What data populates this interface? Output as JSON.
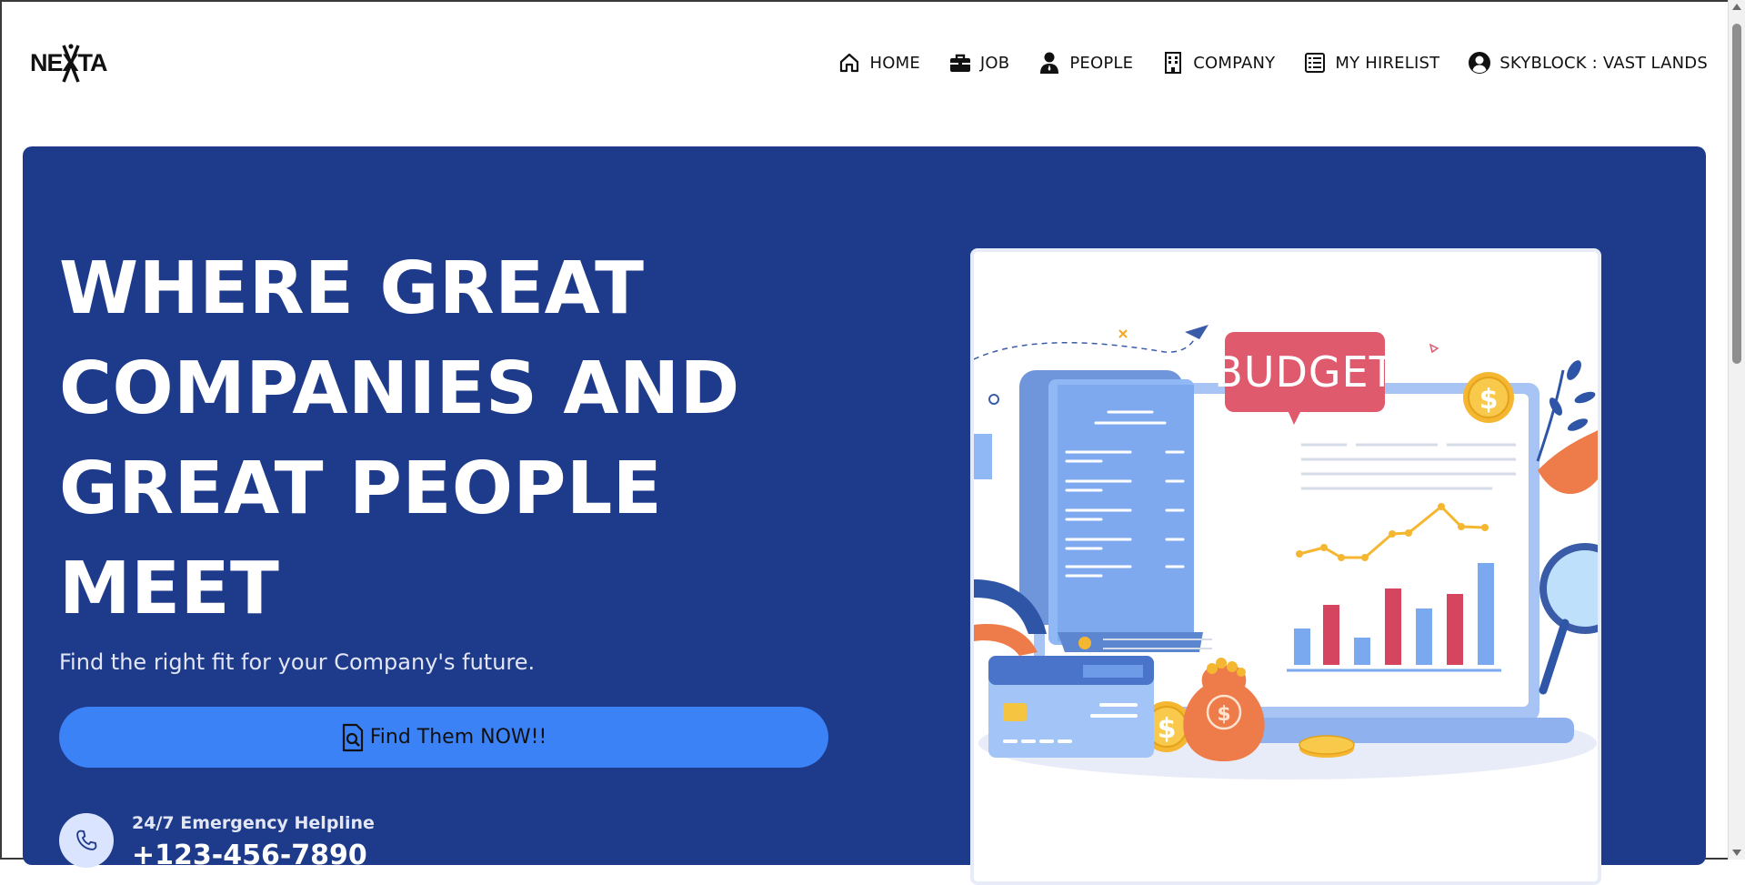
{
  "brand": {
    "logo_text": "NEXTA"
  },
  "nav": {
    "items": [
      {
        "label": "HOME",
        "icon": "home-icon"
      },
      {
        "label": "JOB",
        "icon": "briefcase-icon"
      },
      {
        "label": "PEOPLE",
        "icon": "person-icon"
      },
      {
        "label": "COMPANY",
        "icon": "building-icon"
      },
      {
        "label": "MY HIRELIST",
        "icon": "list-icon"
      },
      {
        "label": "SKYBLOCK : VAST LANDS",
        "icon": "user-circle-icon"
      }
    ]
  },
  "hero": {
    "headline": "WHERE GREAT COMPANIES AND GREAT PEOPLE MEET",
    "subtitle": "Find the right fit for your Company's future.",
    "cta_label": "Find Them NOW!!",
    "helpline_title": "24/7 Emergency Helpline",
    "helpline_number": "+123-456-7890",
    "illustration": {
      "sign_text": "BUDGET"
    }
  },
  "colors": {
    "hero_bg": "#1e3a8a",
    "cta_bg": "#3b82f6",
    "budget_sign": "#e05a6e"
  }
}
